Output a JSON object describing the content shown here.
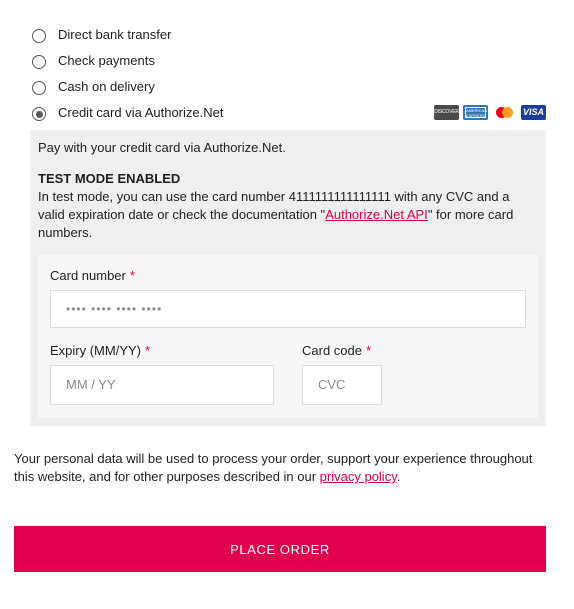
{
  "payment_methods": [
    {
      "label": "Direct bank transfer",
      "selected": false
    },
    {
      "label": "Check payments",
      "selected": false
    },
    {
      "label": "Cash on delivery",
      "selected": false
    },
    {
      "label": "Credit card via Authorize.Net",
      "selected": true
    }
  ],
  "card_icons": {
    "discover": "DISCOVER",
    "amex": "AMERICAN EXPRESS",
    "visa": "VISA"
  },
  "panel": {
    "intro": "Pay with your credit card via Authorize.Net.",
    "test_title": "TEST MODE ENABLED",
    "test_text_before": "In test mode, you can use the card number 4111111111111111 with any CVC and a valid expiration date or check the documentation \"",
    "test_link": "Authorize.Net API",
    "test_text_after": "\" for more card numbers."
  },
  "form": {
    "card_number_label": "Card number",
    "card_number_placeholder": "•••• •••• •••• ••••",
    "expiry_label": "Expiry (MM/YY)",
    "expiry_placeholder": "MM / YY",
    "card_code_label": "Card code",
    "card_code_placeholder": "CVC",
    "required_mark": "*"
  },
  "privacy": {
    "text_before": "Your personal data will be used to process your order, support your experience throughout this website, and for other purposes described in our ",
    "link": "privacy policy",
    "text_after": "."
  },
  "place_order_label": "PLACE ORDER",
  "colors": {
    "accent": "#e2004e",
    "link": "#d6004a",
    "panel_bg": "#efefef"
  }
}
